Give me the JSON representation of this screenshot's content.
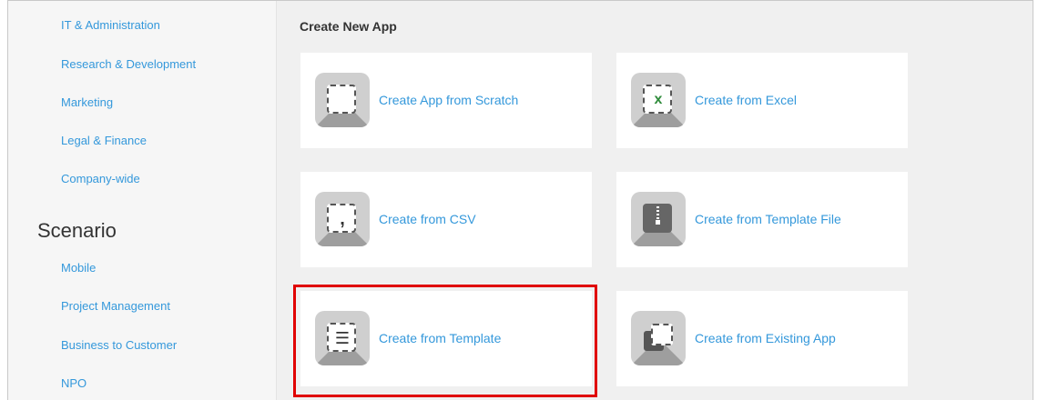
{
  "sidebar": {
    "category_links": [
      "IT & Administration",
      "Research & Development",
      "Marketing",
      "Legal & Finance",
      "Company-wide"
    ],
    "scenario_heading": "Scenario",
    "scenario_links": [
      "Mobile",
      "Project Management",
      "Business to Customer",
      "NPO"
    ]
  },
  "main": {
    "title": "Create New App",
    "cards": [
      {
        "label": "Create App from Scratch",
        "icon": "blank-app-icon"
      },
      {
        "label": "Create from Excel",
        "icon": "excel-icon",
        "glyph": "x"
      },
      {
        "label": "Create from CSV",
        "icon": "csv-icon",
        "glyph": ","
      },
      {
        "label": "Create from Template File",
        "icon": "zip-file-icon"
      },
      {
        "label": "Create from Template",
        "icon": "template-list-icon",
        "glyph": "☰"
      },
      {
        "label": "Create from Existing App",
        "icon": "copy-app-icon"
      }
    ]
  },
  "highlight_color": "#e00000",
  "accent_color": "#3498db"
}
